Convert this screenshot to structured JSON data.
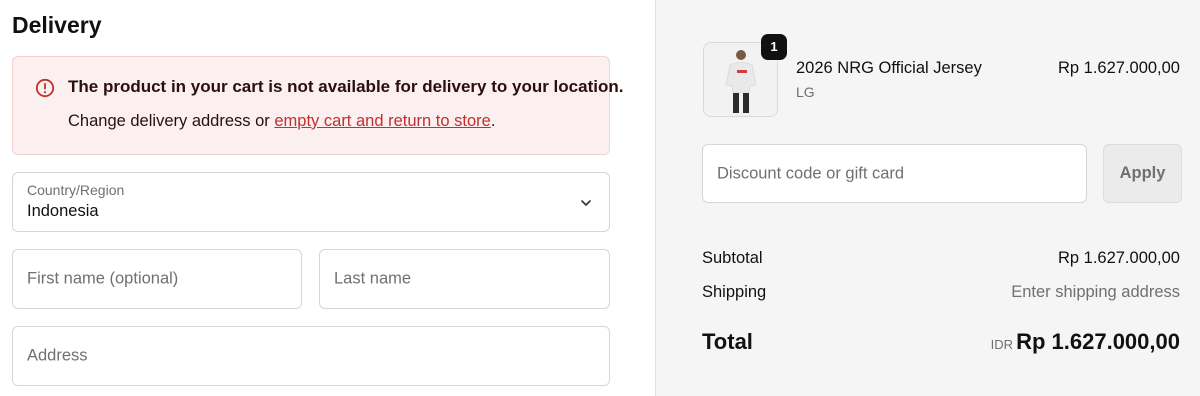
{
  "delivery": {
    "heading": "Delivery",
    "alert": {
      "title": "The product in your cart is not available for delivery to your location.",
      "body_prefix": "Change delivery address or ",
      "link_text": "empty cart and return to store",
      "body_suffix": ".",
      "icon": "alert-circle-icon",
      "color": "#c0312f"
    },
    "country": {
      "label": "Country/Region",
      "value": "Indonesia"
    },
    "first_name": {
      "placeholder": "First name (optional)",
      "value": ""
    },
    "last_name": {
      "placeholder": "Last name",
      "value": ""
    },
    "address": {
      "placeholder": "Address",
      "value": ""
    }
  },
  "summary": {
    "item": {
      "quantity": "1",
      "name": "2026 NRG Official Jersey",
      "variant": "LG",
      "price": "Rp 1.627.000,00"
    },
    "discount": {
      "placeholder": "Discount code or gift card",
      "apply_label": "Apply"
    },
    "subtotal": {
      "label": "Subtotal",
      "value": "Rp 1.627.000,00"
    },
    "shipping": {
      "label": "Shipping",
      "value": "Enter shipping address"
    },
    "total": {
      "label": "Total",
      "currency": "IDR",
      "value": "Rp 1.627.000,00"
    }
  }
}
